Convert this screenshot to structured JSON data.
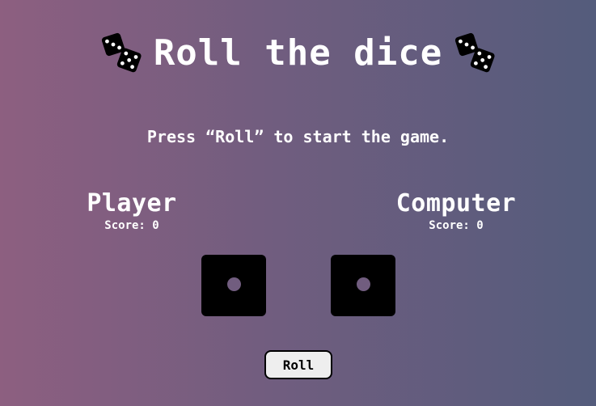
{
  "header": {
    "title": "Roll the dice",
    "left_icon": "dice-icon",
    "right_icon": "dice-icon"
  },
  "status": {
    "message": "Press “Roll” to start the game."
  },
  "players": {
    "player": {
      "name": "Player",
      "score_label": "Score: 0",
      "die_value": 1
    },
    "computer": {
      "name": "Computer",
      "score_label": "Score: 0",
      "die_value": 1
    }
  },
  "controls": {
    "roll_label": "Roll"
  },
  "colors": {
    "background_start": "#8d5f80",
    "background_end": "#545c7c",
    "die_face": "#000000",
    "pip": "#715d7f",
    "button": "#eeeeee"
  }
}
